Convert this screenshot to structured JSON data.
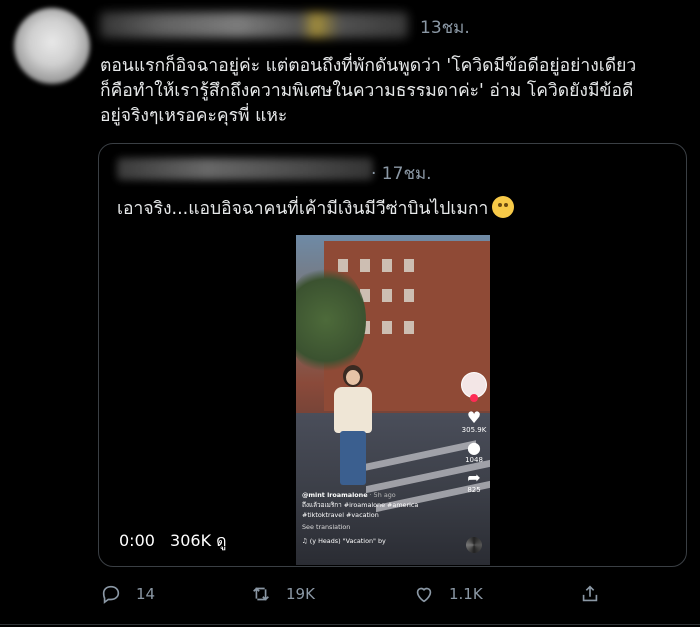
{
  "tweet": {
    "time": "13ชม.",
    "text_lines": [
      "ตอนแรกก็อิจฉาอยู่ค่ะ แต่ตอนถึงที่พักดันพูดว่า 'โควิดมีข้อดีอยู่อย่างเดียว",
      "ก็คือทำให้เรารู้สึกถึงความพิเศษในความธรรมดาค่ะ' อ่าม โควิดยังมีข้อดี",
      "อยู่จริงๆเหรอคะคุรพี่ แหะ"
    ]
  },
  "quote": {
    "time": "· 17ชม.",
    "text": "เอาจริง...แอบอิจฉาคนที่เค้ามีเงินมีวีซ่าบินไปเมกา",
    "emoji": "woozy-face"
  },
  "video": {
    "tiktok": {
      "likes": "305.9K",
      "comments": "1048",
      "shares": "825",
      "username": "@mint lroamalone",
      "posted": "· 5h ago",
      "caption": "ถึงแล้วอเมริกา #iroamalone #america #tiktoktravel #vacation",
      "see_translation": "See translation",
      "music": "♫  (y Heads)   \"Vacation\" by"
    },
    "timestamp": "0:00",
    "views": "306K ดู"
  },
  "actions": {
    "reply_count": "14",
    "retweet_count": "19K",
    "like_count": "1.1K"
  },
  "colors": {
    "background": "#000000",
    "text": "#e7e9ea",
    "muted": "#8b98a5",
    "border": "#3a3f44"
  }
}
